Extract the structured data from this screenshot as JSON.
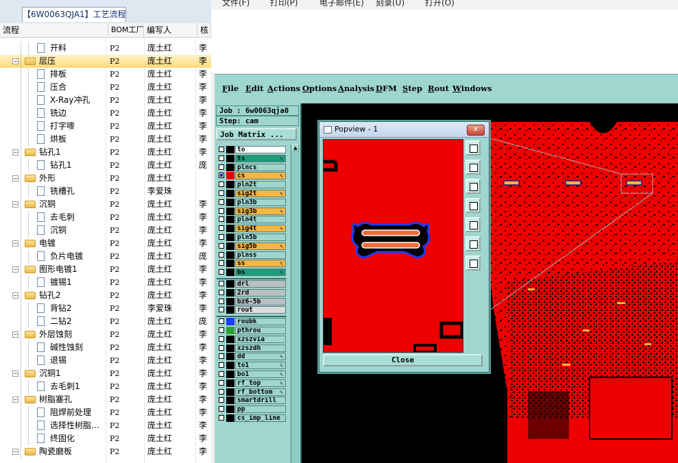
{
  "left_panel": {
    "tab_title": "【6W0063QJA1】工艺流程",
    "columns": [
      "流程",
      "BOM工厂",
      "编写人",
      "核"
    ],
    "rows": [
      {
        "name": "开料",
        "factory": "P2",
        "author": "庞土红",
        "rev": "李",
        "level": 2,
        "kind": "doc",
        "selected": false
      },
      {
        "name": "层压",
        "factory": "P2",
        "author": "庞土红",
        "rev": "李",
        "level": 1,
        "kind": "folder",
        "selected": true
      },
      {
        "name": "排板",
        "factory": "P2",
        "author": "庞土红",
        "rev": "李",
        "level": 2,
        "kind": "doc",
        "selected": false
      },
      {
        "name": "压合",
        "factory": "P2",
        "author": "庞土红",
        "rev": "李",
        "level": 2,
        "kind": "doc",
        "selected": false
      },
      {
        "name": "X-Ray冲孔",
        "factory": "P2",
        "author": "庞土红",
        "rev": "李",
        "level": 2,
        "kind": "doc",
        "selected": false
      },
      {
        "name": "铣边",
        "factory": "P2",
        "author": "庞土红",
        "rev": "李",
        "level": 2,
        "kind": "doc",
        "selected": false
      },
      {
        "name": "打字嘜",
        "factory": "P2",
        "author": "庞土红",
        "rev": "李",
        "level": 2,
        "kind": "doc",
        "selected": false
      },
      {
        "name": "烘板",
        "factory": "P2",
        "author": "庞土红",
        "rev": "李",
        "level": 2,
        "kind": "doc",
        "selected": false
      },
      {
        "name": "钻孔1",
        "factory": "P2",
        "author": "庞土红",
        "rev": "李",
        "level": 1,
        "kind": "folder",
        "selected": false
      },
      {
        "name": "钻孔1",
        "factory": "P2",
        "author": "庞土红",
        "rev": "庞",
        "level": 2,
        "kind": "doc",
        "selected": false
      },
      {
        "name": "外形",
        "factory": "P2",
        "author": "庞土红",
        "rev": "",
        "level": 1,
        "kind": "folder",
        "selected": false
      },
      {
        "name": "铣槽孔",
        "factory": "P2",
        "author": "李爱珠",
        "rev": "",
        "level": 2,
        "kind": "doc",
        "selected": false
      },
      {
        "name": "沉铜",
        "factory": "P2",
        "author": "庞土红",
        "rev": "李",
        "level": 1,
        "kind": "folder",
        "selected": false
      },
      {
        "name": "去毛刺",
        "factory": "P2",
        "author": "庞土红",
        "rev": "李",
        "level": 2,
        "kind": "doc",
        "selected": false
      },
      {
        "name": "沉铜",
        "factory": "P2",
        "author": "庞土红",
        "rev": "李",
        "level": 2,
        "kind": "doc",
        "selected": false
      },
      {
        "name": "电镀",
        "factory": "P2",
        "author": "庞土红",
        "rev": "李",
        "level": 1,
        "kind": "folder",
        "selected": false
      },
      {
        "name": "负片电镀",
        "factory": "P2",
        "author": "庞土红",
        "rev": "庞",
        "level": 2,
        "kind": "doc",
        "selected": false
      },
      {
        "name": "图形电镀1",
        "factory": "P2",
        "author": "庞土红",
        "rev": "李",
        "level": 1,
        "kind": "folder",
        "selected": false
      },
      {
        "name": "镀锡1",
        "factory": "P2",
        "author": "庞土红",
        "rev": "李",
        "level": 2,
        "kind": "doc",
        "selected": false
      },
      {
        "name": "钻孔2",
        "factory": "P2",
        "author": "庞土红",
        "rev": "李",
        "level": 1,
        "kind": "folder",
        "selected": false
      },
      {
        "name": "背钻2",
        "factory": "P2",
        "author": "李爱珠",
        "rev": "李",
        "level": 2,
        "kind": "doc",
        "selected": false
      },
      {
        "name": "二钻2",
        "factory": "P2",
        "author": "庞土红",
        "rev": "庞",
        "level": 2,
        "kind": "doc",
        "selected": false
      },
      {
        "name": "外层蚀刻",
        "factory": "P2",
        "author": "庞土红",
        "rev": "李",
        "level": 1,
        "kind": "folder",
        "selected": false
      },
      {
        "name": "碱性蚀刻",
        "factory": "P2",
        "author": "庞土红",
        "rev": "李",
        "level": 2,
        "kind": "doc",
        "selected": false
      },
      {
        "name": "退锡",
        "factory": "P2",
        "author": "庞土红",
        "rev": "李",
        "level": 2,
        "kind": "doc",
        "selected": false
      },
      {
        "name": "沉铜1",
        "factory": "P2",
        "author": "庞土红",
        "rev": "李",
        "level": 1,
        "kind": "folder",
        "selected": false
      },
      {
        "name": "去毛刺1",
        "factory": "P2",
        "author": "庞土红",
        "rev": "李",
        "level": 2,
        "kind": "doc",
        "selected": false
      },
      {
        "name": "树脂塞孔",
        "factory": "P2",
        "author": "庞土红",
        "rev": "李",
        "level": 1,
        "kind": "folder",
        "selected": false
      },
      {
        "name": "阻焊前处理",
        "factory": "P2",
        "author": "庞土红",
        "rev": "李",
        "level": 2,
        "kind": "doc",
        "selected": false
      },
      {
        "name": "选择性树脂…",
        "factory": "P2",
        "author": "庞土红",
        "rev": "李",
        "level": 2,
        "kind": "doc",
        "selected": false
      },
      {
        "name": "终固化",
        "factory": "P2",
        "author": "庞土红",
        "rev": "李",
        "level": 2,
        "kind": "doc",
        "selected": false
      },
      {
        "name": "陶瓷磨板",
        "factory": "P2",
        "author": "庞土红",
        "rev": "李",
        "level": 1,
        "kind": "folder",
        "selected": false
      }
    ]
  },
  "cam": {
    "top_menu": [
      "文件(F)",
      "打印(P)",
      "电子邮件(E)",
      "刻录(U)",
      "打开(O)"
    ],
    "menubar": [
      "File",
      "Edit",
      "Actions",
      "Options",
      "Analysis",
      "DFM",
      "Step",
      "Rout",
      "Windows"
    ],
    "job_label": "Job : 6w0063qja0",
    "step_label": "Step: cam",
    "job_matrix_label": "Job Matrix ...",
    "layers": [
      {
        "name": "to",
        "color": "#ffffff",
        "swatch": "#000000",
        "checked": false,
        "edit": false
      },
      {
        "name": "ts",
        "color": "#1f9c7a",
        "swatch": "#000000",
        "checked": false,
        "edit": true
      },
      {
        "name": "plncs",
        "color": "#9fd6cf",
        "swatch": "#000000",
        "checked": false,
        "edit": false
      },
      {
        "name": "cs",
        "color": "#f5b643",
        "swatch": "#e00000",
        "checked": true,
        "edit": true
      },
      {
        "name": "pln2t",
        "color": "#9fd6cf",
        "swatch": "#000000",
        "checked": false,
        "edit": false
      },
      {
        "name": "sig2t",
        "color": "#f5b643",
        "swatch": "#000000",
        "checked": false,
        "edit": true
      },
      {
        "name": "pln3b",
        "color": "#9fd6cf",
        "swatch": "#000000",
        "checked": false,
        "edit": false
      },
      {
        "name": "sig3b",
        "color": "#f5b643",
        "swatch": "#000000",
        "checked": false,
        "edit": true
      },
      {
        "name": "pln4t",
        "color": "#9fd6cf",
        "swatch": "#000000",
        "checked": false,
        "edit": false
      },
      {
        "name": "sig4t",
        "color": "#f5b643",
        "swatch": "#000000",
        "checked": false,
        "edit": true
      },
      {
        "name": "pln5b",
        "color": "#9fd6cf",
        "swatch": "#000000",
        "checked": false,
        "edit": false
      },
      {
        "name": "sig5b",
        "color": "#f5b643",
        "swatch": "#000000",
        "checked": false,
        "edit": true
      },
      {
        "name": "plnss",
        "color": "#9fd6cf",
        "swatch": "#000000",
        "checked": false,
        "edit": false
      },
      {
        "name": "ss",
        "color": "#f5b643",
        "swatch": "#000000",
        "checked": false,
        "edit": true
      },
      {
        "name": "bs",
        "color": "#1f9c7a",
        "swatch": "#000000",
        "checked": false,
        "edit": true
      },
      {
        "name": "drl",
        "color": "#b7c0c2",
        "swatch": "#000000",
        "checked": false,
        "edit": false
      },
      {
        "name": "2rd",
        "color": "#b7c0c2",
        "swatch": "#000000",
        "checked": false,
        "edit": false
      },
      {
        "name": "bz6-5b",
        "color": "#b7c0c2",
        "swatch": "#000000",
        "checked": false,
        "edit": false
      },
      {
        "name": "rout",
        "color": "#dcdcdc",
        "swatch": "#000000",
        "checked": false,
        "edit": false
      },
      {
        "name": "roubk",
        "color": "#9fd6cf",
        "swatch": "#1a3cff",
        "checked": false,
        "edit": false
      },
      {
        "name": "pthrou",
        "color": "#9fd6cf",
        "swatch": "#2fa32f",
        "checked": false,
        "edit": false
      },
      {
        "name": "xzszvia",
        "color": "#9fd6cf",
        "swatch": "#000000",
        "checked": false,
        "edit": false
      },
      {
        "name": "xzszdh",
        "color": "#9fd6cf",
        "swatch": "#000000",
        "checked": false,
        "edit": false
      },
      {
        "name": "dd",
        "color": "#9fd6cf",
        "swatch": "#000000",
        "checked": false,
        "edit": true
      },
      {
        "name": "to1",
        "color": "#9fd6cf",
        "swatch": "#000000",
        "checked": false,
        "edit": true
      },
      {
        "name": "bo1",
        "color": "#9fd6cf",
        "swatch": "#000000",
        "checked": false,
        "edit": true
      },
      {
        "name": "rf_top",
        "color": "#9fd6cf",
        "swatch": "#000000",
        "checked": false,
        "edit": true
      },
      {
        "name": "rf_bottom",
        "color": "#9fd6cf",
        "swatch": "#000000",
        "checked": false,
        "edit": true
      },
      {
        "name": "smartdrill",
        "color": "#9fd6cf",
        "swatch": "#000000",
        "checked": false,
        "edit": false
      },
      {
        "name": "pp",
        "color": "#9fd6cf",
        "swatch": "#000000",
        "checked": false,
        "edit": false
      },
      {
        "name": "cs_imp_line",
        "color": "#9fd6cf",
        "swatch": "#000000",
        "checked": false,
        "edit": false
      }
    ],
    "popview": {
      "title": "Popview - 1",
      "close_label": "Close"
    },
    "colors": {
      "board_red": "#ef0000",
      "panel_teal": "#9fd6cf"
    }
  }
}
